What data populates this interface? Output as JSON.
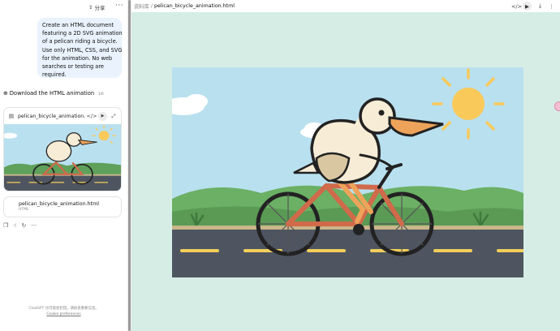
{
  "left_panel": {
    "share_label": "分享",
    "more_label": "···",
    "prompt_lines": [
      "Create an HTML document",
      "featuring a 2D SVG animation",
      "of a pelican riding a bicycle.",
      "Use only HTML, CSS, and SVG",
      "for the animation. No web",
      "searches or testing are",
      "required."
    ],
    "download_title": "Download the HTML animation",
    "download_badge": "1/6",
    "card_filename": "pelican_bicycle_animation.html",
    "file_name": "pelican_bicycle_animation.html",
    "file_type": "HTML",
    "footer_disclaimer": "ChatGPT 也可能会犯错。请核查重要信息。",
    "footer_cookie": "Cookie preferences"
  },
  "right_panel": {
    "breadcrumb_root": "资料库",
    "breadcrumb_sep": "/",
    "breadcrumb_file": "pelican_bicycle_animation.html"
  },
  "icons": {
    "share": "share-icon",
    "more": "more-icon",
    "globe": "globe-icon",
    "file": "file-icon",
    "play": "play-icon",
    "expand": "expand-icon",
    "copy": "copy-icon",
    "like": "thumbs-up-icon",
    "regenerate": "regenerate-icon",
    "code": "code-icon",
    "download": "download-icon"
  },
  "colors": {
    "bubble": "#e9f2fd",
    "panel_bg": "#d6ede6",
    "sky": "#b9e0ef",
    "sun": "#f9c95a",
    "grass": "#5fa05b",
    "road": "#4e5560",
    "lane": "#f2cf5b",
    "bike_frame": "#d06a4a",
    "pelican_body": "#f7ecd6",
    "beak": "#eea35a"
  }
}
